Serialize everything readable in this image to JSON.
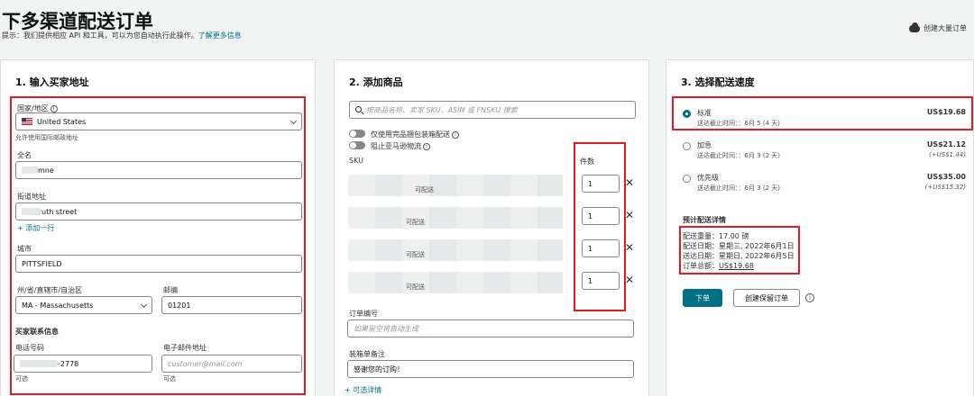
{
  "header": {
    "title": "下多渠道配送订单",
    "hint": "提示：我们提供相应 API 和工具，可以为您自动执行此操作。",
    "hint_link": "了解更多信息",
    "create_bulk": "创建大量订单"
  },
  "address": {
    "title": "1. 输入买家地址",
    "country_label": "国家/地区",
    "country_value": "United States",
    "country_note": "允许使用国际邮政地址",
    "name_label": "全名",
    "name_value": "mne",
    "street_label": "街道地址",
    "street_value": "uth street",
    "add_line": "添加一行",
    "city_label": "城市",
    "city_value": "PITTSFIELD",
    "state_label": "州/省/直辖市/自治区",
    "state_value": "MA - Massachusetts",
    "zip_label": "邮编",
    "zip_value": "01201",
    "contact_title": "买家联系信息",
    "phone_label": "电话号码",
    "phone_value": "-2778",
    "phone_note": "可选",
    "email_label": "电子邮件地址",
    "email_placeholder": "customer@mail.com",
    "email_note": "可选"
  },
  "products": {
    "title": "2. 添加商品",
    "search_placeholder": "按商品名称、卖家 SKU、ASIN 或 FNSKU 搜索",
    "toggle1": "仅使用完品捆包装箱配送",
    "toggle2": "阻止亚马逊物流",
    "col_sku": "SKU",
    "col_qty": "件数",
    "rows": [
      {
        "status": "可配送",
        "qty": "1"
      },
      {
        "status": "可配送",
        "qty": "1"
      },
      {
        "status": "可配送",
        "qty": "1"
      },
      {
        "status": "可配送",
        "qty": "1"
      }
    ],
    "order_no_label": "订单编号",
    "order_no_placeholder": "如果留空将自动生成",
    "packing_label": "装箱单备注",
    "packing_value": "感谢您的订购！",
    "add_detail": "可选详情"
  },
  "shipping": {
    "title": "3. 选择配送速度",
    "options": [
      {
        "name": "标准",
        "eta": "送达截止时间：：6月 5 (4 天)",
        "price": "US$19.68",
        "extra": ""
      },
      {
        "name": "加急",
        "eta": "送达截止时间：：6月 3 (2 天)",
        "price": "US$21.12",
        "extra": "(+US$1.44)"
      },
      {
        "name": "优先级",
        "eta": "送达截止时间：：6月 3 (2 天)",
        "price": "US$35.00",
        "extra": "(+US$15.32)"
      }
    ],
    "details_title": "预计配送详情",
    "details": [
      "配送重量：17.00 磅",
      "配送日期：星期三, 2022年6月1日",
      "送达日期：星期日, 2022年6月5日",
      "订单总额："
    ],
    "total": "US$19.68",
    "submit": "下单",
    "save_draft": "创建保留订单"
  },
  "colors": {
    "accent": "#007185",
    "highlight": "#e31b23"
  }
}
